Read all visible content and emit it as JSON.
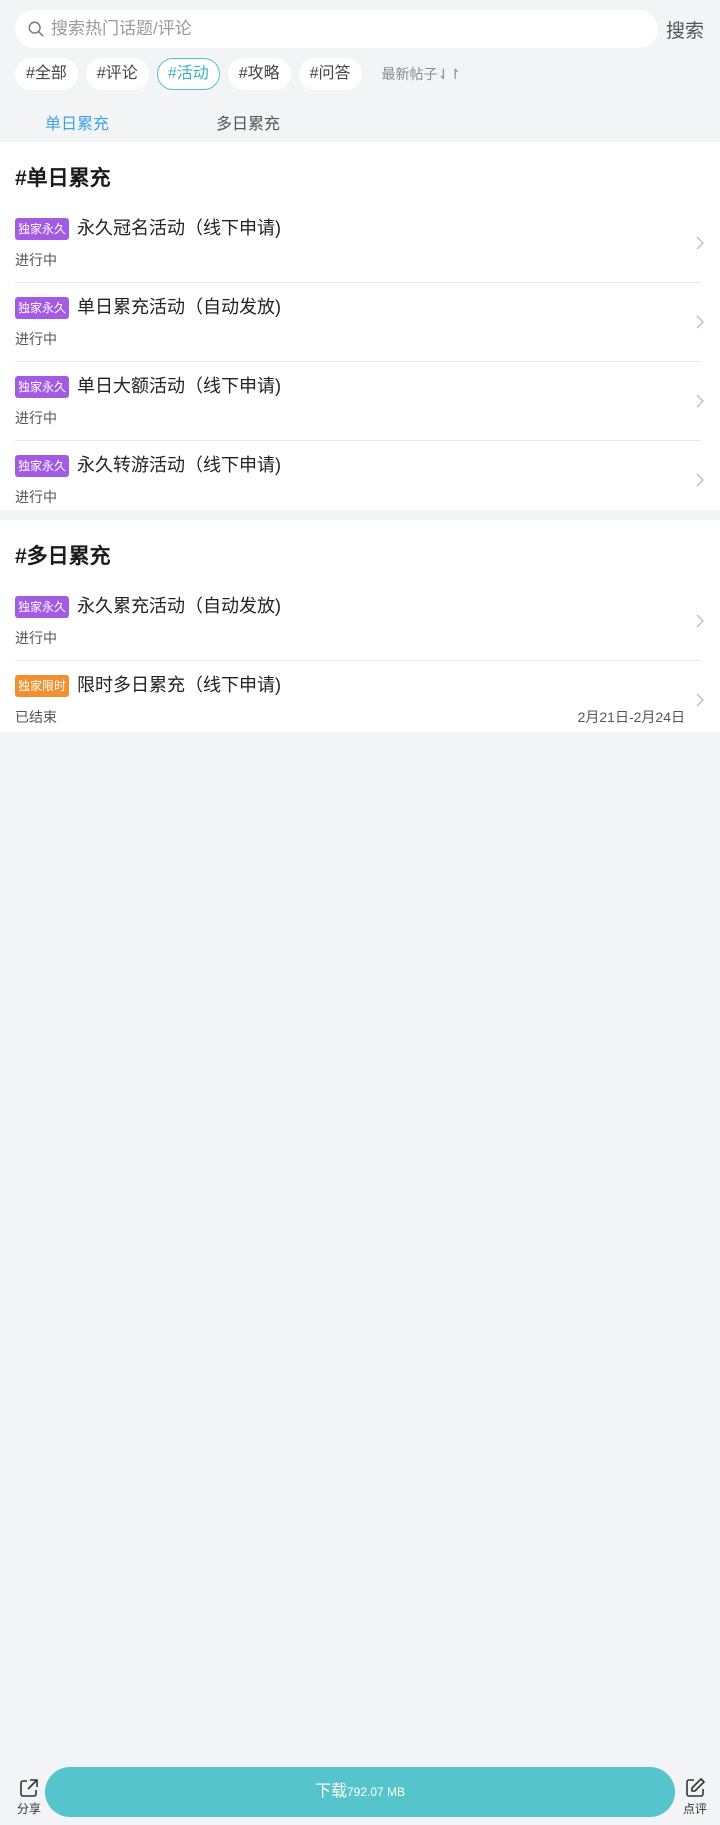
{
  "search": {
    "placeholder": "搜索热门话题/评论",
    "button_label": "搜索"
  },
  "filter_chips": [
    {
      "label": "#全部",
      "active": false
    },
    {
      "label": "#评论",
      "active": false
    },
    {
      "label": "#活动",
      "active": true
    },
    {
      "label": "#攻略",
      "active": false
    },
    {
      "label": "#问答",
      "active": false
    }
  ],
  "sort_label": "最新帖子",
  "sub_tabs": [
    {
      "label": "单日累充",
      "active": true
    },
    {
      "label": "多日累充",
      "active": false
    }
  ],
  "sections": [
    {
      "title": "#单日累充",
      "items": [
        {
          "badge": "独家永久",
          "badge_color": "#a45be4",
          "title": "永久冠名活动（线下申请)",
          "status": "进行中"
        },
        {
          "badge": "独家永久",
          "badge_color": "#a45be4",
          "title": "单日累充活动（自动发放)",
          "status": "进行中"
        },
        {
          "badge": "独家永久",
          "badge_color": "#a45be4",
          "title": "单日大额活动（线下申请)",
          "status": "进行中"
        },
        {
          "badge": "独家永久",
          "badge_color": "#a45be4",
          "title": "永久转游活动（线下申请)",
          "status": "进行中"
        }
      ]
    },
    {
      "title": "#多日累充",
      "items": [
        {
          "badge": "独家永久",
          "badge_color": "#a45be4",
          "title": "永久累充活动（自动发放)",
          "status": "进行中"
        },
        {
          "badge": "独家限时",
          "badge_color": "#f1902f",
          "title": "限时多日累充（线下申请)",
          "status": "已结束",
          "date": "2月21日-2月24日"
        }
      ]
    }
  ],
  "bottom_bar": {
    "share_label": "分享",
    "review_label": "点评",
    "download_label": "下载",
    "download_size": "792.07 MB"
  },
  "colors": {
    "accent": "#55c5cb",
    "tab_active": "#3fa1e8",
    "badge_purple": "#a45be4",
    "badge_orange": "#f1902f"
  },
  "icons": {
    "search": "search-icon",
    "chevron": "chevron-right-icon",
    "sort": "sort-icon",
    "share": "share-icon",
    "review": "edit-icon"
  }
}
